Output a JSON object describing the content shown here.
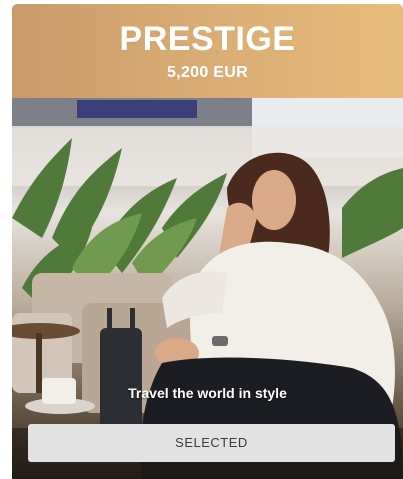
{
  "card": {
    "tier_name": "PRESTIGE",
    "price": "5,200 EUR",
    "tagline": "Travel the world in style",
    "button_label": "SELECTED",
    "header_gradient": [
      "#c99a6a",
      "#e7bc7a"
    ],
    "button_color": "#e2e2e2"
  }
}
